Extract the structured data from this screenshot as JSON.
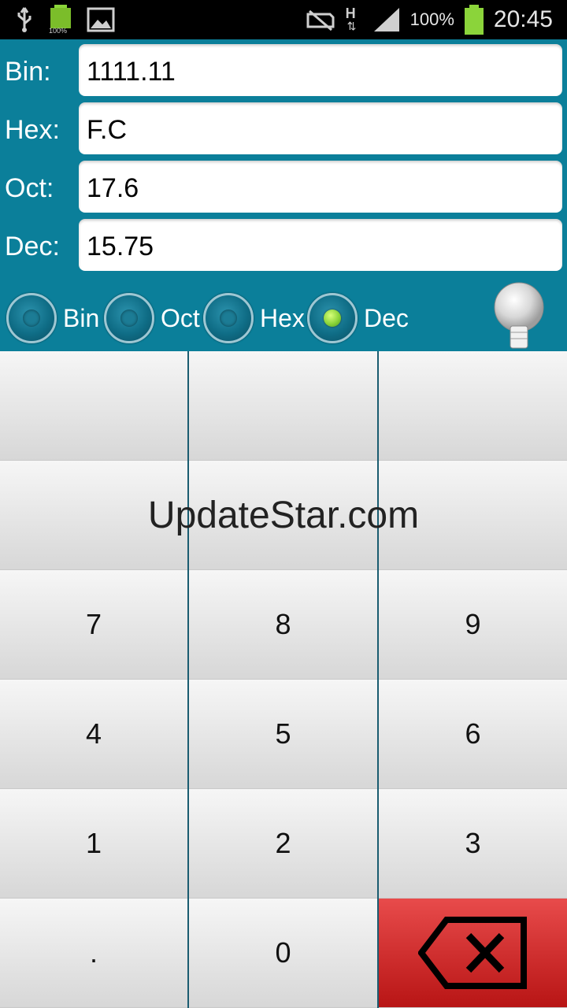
{
  "status": {
    "time": "20:45",
    "battery_percent": "100%",
    "battery_small_label": "100%",
    "network": "H"
  },
  "fields": [
    {
      "label": "Bin:",
      "value": "1111.11"
    },
    {
      "label": "Hex:",
      "value": "F.C"
    },
    {
      "label": "Oct:",
      "value": "17.6"
    },
    {
      "label": "Dec:",
      "value": "15.75"
    }
  ],
  "radios": [
    {
      "label": "Bin",
      "selected": false
    },
    {
      "label": "Oct",
      "selected": false
    },
    {
      "label": "Hex",
      "selected": false
    },
    {
      "label": "Dec",
      "selected": true
    }
  ],
  "keypad": {
    "rows": [
      [
        "",
        "",
        ""
      ],
      [
        "",
        "",
        ""
      ],
      [
        "7",
        "8",
        "9"
      ],
      [
        "4",
        "5",
        "6"
      ],
      [
        "1",
        "2",
        "3"
      ],
      [
        ".",
        "0",
        "backspace-icon"
      ]
    ]
  },
  "watermark": "UpdateStar.com",
  "colors": {
    "panel": "#0b7f9a",
    "backspace": "#d32f2f",
    "selected_radio": "#8bd43a"
  }
}
